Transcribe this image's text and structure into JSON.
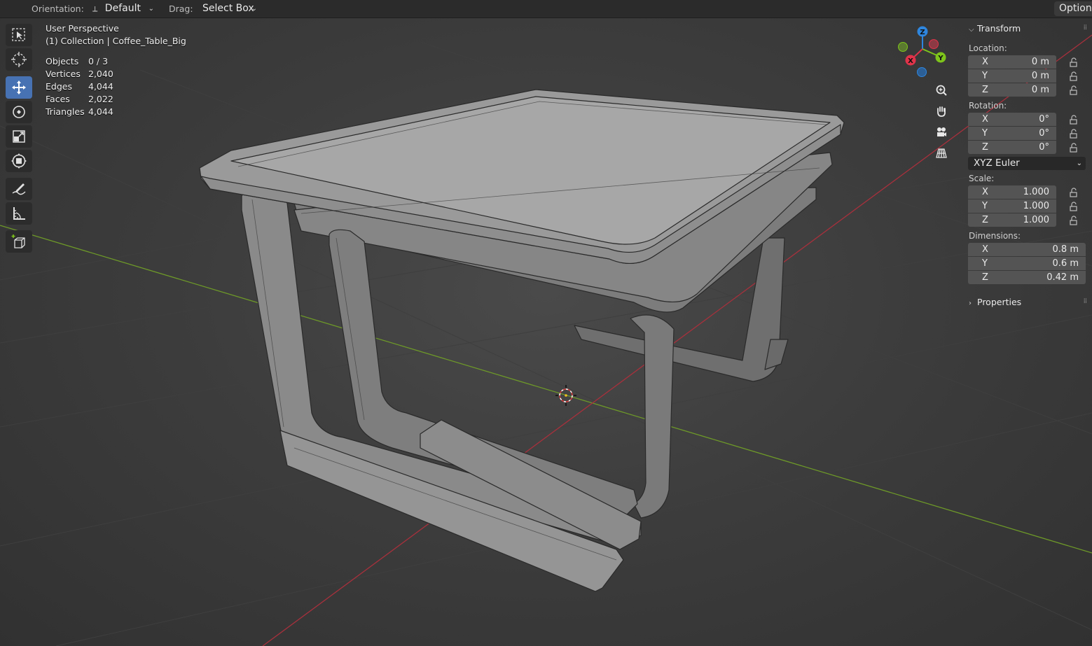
{
  "header": {
    "orientation_label": "Orientation:",
    "orientation_value": "Default",
    "drag_label": "Drag:",
    "drag_value": "Select Box",
    "options_label": "Options"
  },
  "viewport": {
    "view_name": "User Perspective",
    "collection_line": "(1) Collection | Coffee_Table_Big",
    "stats": [
      {
        "label": "Objects",
        "value": "0 / 3"
      },
      {
        "label": "Vertices",
        "value": "2,040"
      },
      {
        "label": "Edges",
        "value": "4,044"
      },
      {
        "label": "Faces",
        "value": "2,022"
      },
      {
        "label": "Triangles",
        "value": "4,044"
      }
    ]
  },
  "toolbar": {
    "tools": [
      {
        "name": "select-box-tool",
        "active": false
      },
      {
        "name": "cursor-tool",
        "active": false
      },
      {
        "name": "move-tool",
        "active": true
      },
      {
        "name": "rotate-tool",
        "active": false
      },
      {
        "name": "scale-tool",
        "active": false
      },
      {
        "name": "transform-tool",
        "active": false
      },
      {
        "name": "annotate-tool",
        "active": false
      },
      {
        "name": "measure-tool",
        "active": false
      },
      {
        "name": "add-cube-tool",
        "active": false
      }
    ]
  },
  "gizmo": {
    "axes": {
      "x": "X",
      "y": "Y",
      "z": "Z"
    },
    "colors": {
      "x": "#e0334a",
      "y": "#7ec41b",
      "z": "#2e86de",
      "x_neg": "#8c3a44",
      "y_neg": "#5b7a2f",
      "z_neg": "#2c5f96"
    },
    "nav_buttons": [
      "zoom-icon",
      "pan-hand-icon",
      "camera-icon",
      "grid-perspective-icon"
    ]
  },
  "sidebar": {
    "transform_title": "Transform",
    "location_label": "Location:",
    "location": [
      {
        "axis": "X",
        "value": "0 m"
      },
      {
        "axis": "Y",
        "value": "0 m"
      },
      {
        "axis": "Z",
        "value": "0 m"
      }
    ],
    "rotation_label": "Rotation:",
    "rotation": [
      {
        "axis": "X",
        "value": "0°"
      },
      {
        "axis": "Y",
        "value": "0°"
      },
      {
        "axis": "Z",
        "value": "0°"
      }
    ],
    "rotation_mode": "XYZ Euler",
    "scale_label": "Scale:",
    "scale": [
      {
        "axis": "X",
        "value": "1.000"
      },
      {
        "axis": "Y",
        "value": "1.000"
      },
      {
        "axis": "Z",
        "value": "1.000"
      }
    ],
    "dimensions_label": "Dimensions:",
    "dimensions": [
      {
        "axis": "X",
        "value": "0.8 m"
      },
      {
        "axis": "Y",
        "value": "0.6 m"
      },
      {
        "axis": "Z",
        "value": "0.42 m"
      }
    ],
    "properties_title": "Properties"
  },
  "colors": {
    "accent": "#4772b3",
    "x_axis_line": "#a8303c",
    "y_axis_line": "#6e9a28"
  }
}
